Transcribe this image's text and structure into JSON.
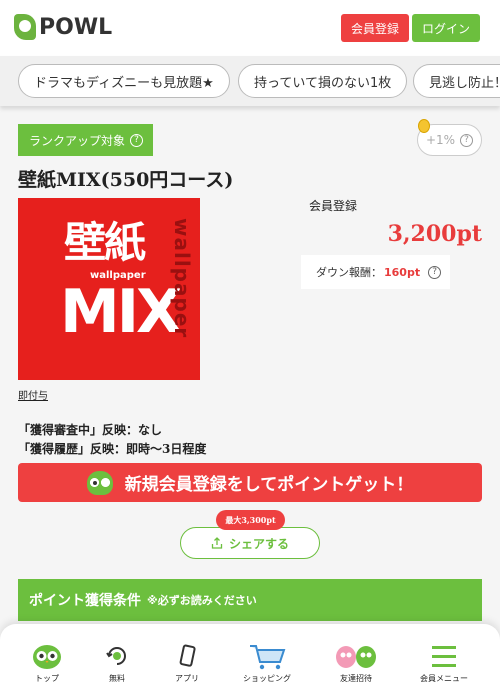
{
  "header": {
    "logo_text": "POWL",
    "register_label": "会員登録",
    "login_label": "ログイン"
  },
  "tags": [
    {
      "label": "ドラマもディズニーも見放題★"
    },
    {
      "label": "持っていて損のない1枚"
    },
    {
      "label": "見逃し防止！"
    }
  ],
  "offer": {
    "rank_label": "ランクアップ対象",
    "bonus_label": "+1%",
    "title": "壁紙MIX(550円コース)",
    "thumbnail": {
      "main_text": "壁紙",
      "sub_text": "wallpaper",
      "mix_text": "MIX",
      "side_text": "wallpaper"
    },
    "member_label": "会員登録",
    "points": "3,200pt",
    "down_label": "ダウン報酬：",
    "down_value": "160pt",
    "instant_label": "即付与",
    "reflect_line1": "「獲得審査中」反映：なし",
    "reflect_line2": "「獲得履歴」反映：即時～3日程度",
    "cta_label": "新規会員登録をしてポイントゲット！",
    "max_badge": "最大3,300pt",
    "share_label": "シェアする",
    "conditions_title": "ポイント獲得条件",
    "conditions_note": "※必ずお読みください"
  },
  "nav": [
    {
      "label": "トップ",
      "icon": "owl-icon"
    },
    {
      "label": "無料",
      "icon": "free-icon"
    },
    {
      "label": "アプリ",
      "icon": "phone-icon"
    },
    {
      "label": "ショッピング",
      "icon": "cart-icon"
    },
    {
      "label": "友達招待",
      "icon": "friends-icon"
    },
    {
      "label": "会員メニュー",
      "icon": "menu-icon"
    }
  ],
  "colors": {
    "brand_green": "#6cbf3e",
    "accent_red": "#ee4040",
    "point_red": "#e83c3c"
  }
}
